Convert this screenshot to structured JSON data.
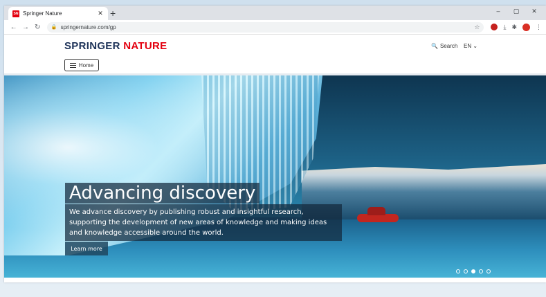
{
  "browser": {
    "tab_title": "Springer Nature",
    "favicon_text": "SN",
    "tab_close": "✕",
    "new_tab": "+",
    "url": "springernature.com/gp",
    "window_minimize": "–",
    "window_maximize": "▢",
    "window_close": "✕"
  },
  "site": {
    "logo_part1": "SPRINGER",
    "logo_part2": "NATURE",
    "search_label": "Search",
    "lang_label": "EN",
    "home_label": "Home"
  },
  "hero": {
    "title": "Advancing discovery",
    "text": "We advance discovery by publishing robust and insightful research, supporting the development of new areas of knowledge and making ideas and knowledge accessible around the world.",
    "learn_more": "Learn more",
    "slides_total": 5,
    "slide_active": 3
  },
  "colors": {
    "brand_red": "#e3000f",
    "brand_navy": "#1d3258"
  }
}
